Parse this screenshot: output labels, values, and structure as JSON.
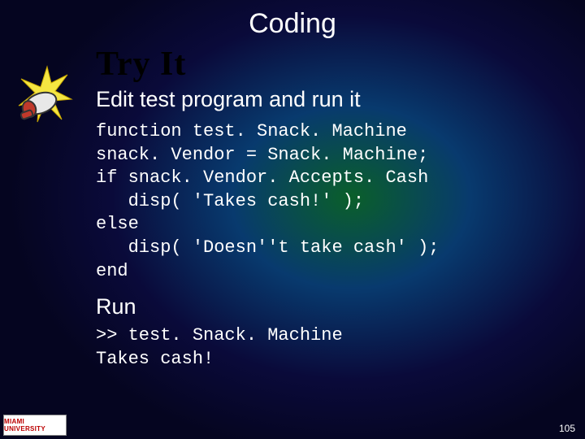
{
  "title": "Coding",
  "tryit": "Try It",
  "subhead": "Edit test program and run it",
  "code": "function test. Snack. Machine\nsnack. Vendor = Snack. Machine;\nif snack. Vendor. Accepts. Cash\n   disp( 'Takes cash!' );\nelse\n   disp( 'Doesn''t take cash' );\nend",
  "run_head": "Run",
  "run_out": ">> test. Snack. Machine\nTakes cash!",
  "logo": "MIAMI UNIVERSITY",
  "pagenum": "105"
}
